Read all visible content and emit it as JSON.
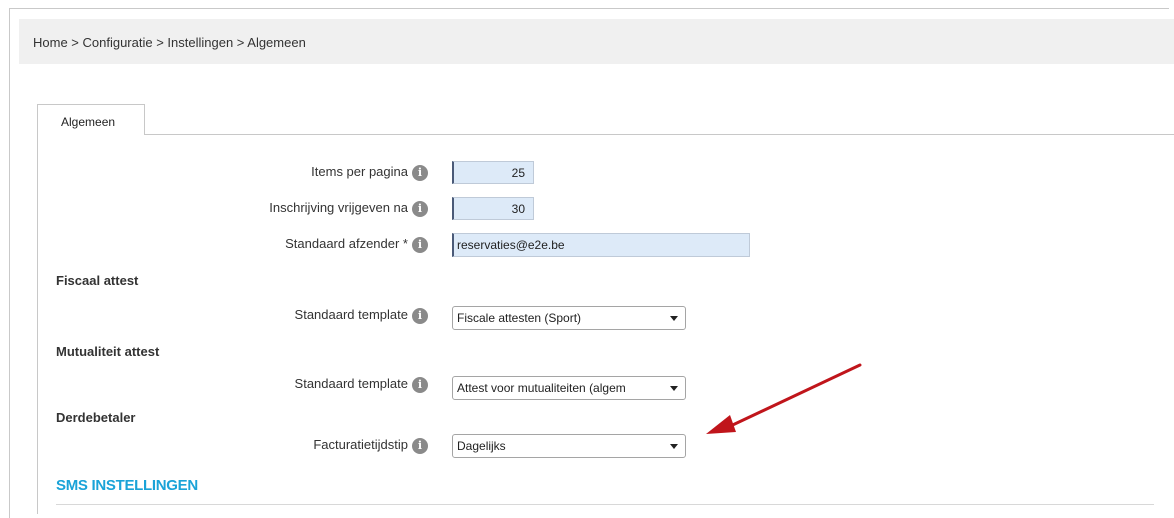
{
  "breadcrumb": "Home > Configuratie > Instellingen > Algemeen",
  "tabs": [
    {
      "label": "Algemeen"
    }
  ],
  "fields": {
    "items_per_pagina": {
      "label": "Items per pagina",
      "value": "25"
    },
    "inschrijving": {
      "label": "Inschrijving vrijgeven na",
      "value": "30"
    },
    "afzender": {
      "label": "Standaard afzender *",
      "value": "reservaties@e2e.be"
    }
  },
  "fiscaal": {
    "title": "Fiscaal attest",
    "template_label": "Standaard template",
    "template_value": "Fiscale attesten (Sport)"
  },
  "mutualiteit": {
    "title": "Mutualiteit attest",
    "template_label": "Standaard template",
    "template_value": "Attest voor mutualiteiten (algem"
  },
  "derdebetaler": {
    "title": "Derdebetaler",
    "facturatie_label": "Facturatietijdstip",
    "facturatie_value": "Dagelijks"
  },
  "sms": {
    "title": "SMS INSTELLINGEN"
  },
  "icons": {
    "info": "info-icon",
    "annotation": "red-arrow-annotation"
  },
  "colors": {
    "accent": "#1aa3d8",
    "input_bg": "#ddeaf8",
    "arrow": "#c0151b"
  }
}
